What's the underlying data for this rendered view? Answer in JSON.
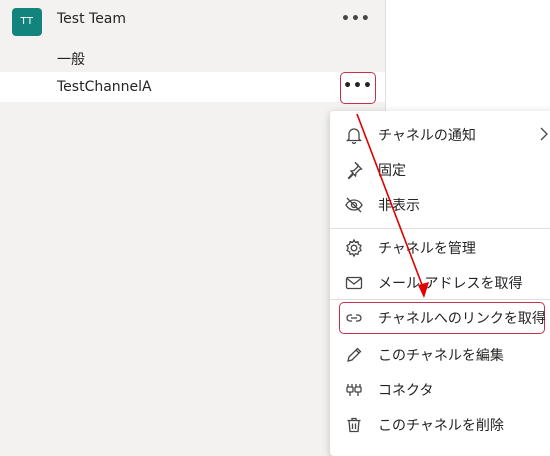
{
  "team": {
    "avatar_initials": "TT",
    "name": "Test Team",
    "more_label": "•••"
  },
  "channels": [
    {
      "label": "一般"
    },
    {
      "label": "TestChannelA",
      "more_label": "•••"
    }
  ],
  "menu": {
    "items": [
      {
        "label": "チャネルの通知",
        "icon": "bell-icon"
      },
      {
        "label": "固定",
        "icon": "pin-icon"
      },
      {
        "label": "非表示",
        "icon": "eye-off-icon"
      },
      {
        "label": "チャネルを管理",
        "icon": "gear-icon"
      },
      {
        "label": "メール アドレスを取得",
        "icon": "mail-icon"
      },
      {
        "label": "チャネルへのリンクを取得",
        "icon": "link-icon"
      },
      {
        "label": "このチャネルを編集",
        "icon": "pencil-icon"
      },
      {
        "label": "コネクタ",
        "icon": "connector-icon"
      },
      {
        "label": "このチャネルを削除",
        "icon": "trash-icon"
      }
    ]
  },
  "colors": {
    "accent_team": "#13837d",
    "annotation_red": "#c4314b",
    "arrow_red": "#e00000"
  }
}
